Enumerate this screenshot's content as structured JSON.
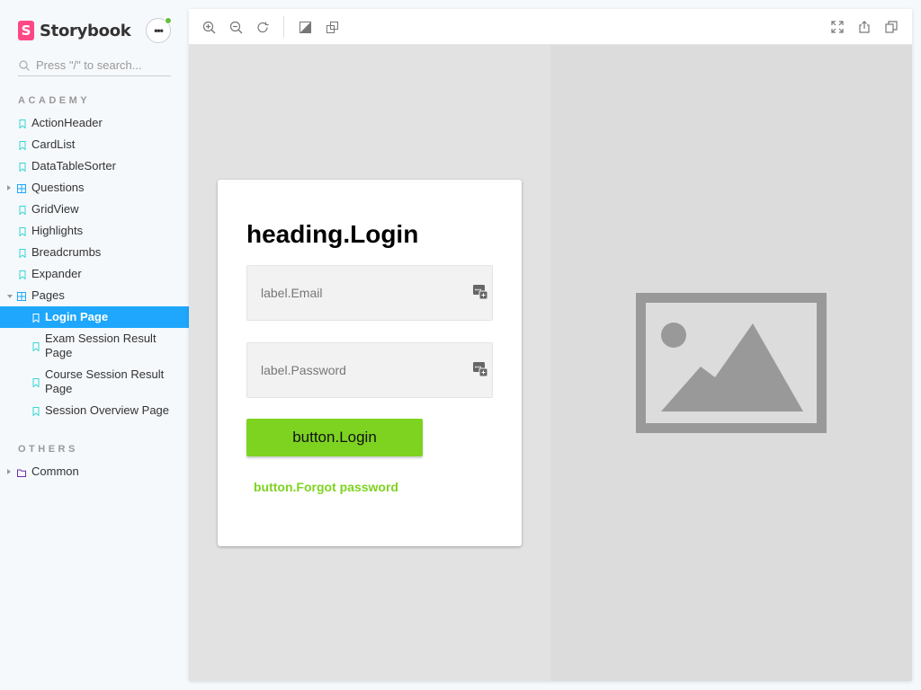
{
  "app": {
    "brand": "Storybook"
  },
  "search": {
    "placeholder": "Press \"/\" to search..."
  },
  "sections": [
    {
      "title": "ACADEMY"
    },
    {
      "title": "OTHERS"
    }
  ],
  "nav": [
    {
      "label": "ActionHeader",
      "kind": "story"
    },
    {
      "label": "CardList",
      "kind": "story"
    },
    {
      "label": "DataTableSorter",
      "kind": "story"
    },
    {
      "label": "Questions",
      "kind": "component",
      "expanded": false
    },
    {
      "label": "GridView",
      "kind": "story"
    },
    {
      "label": "Highlights",
      "kind": "story"
    },
    {
      "label": "Breadcrumbs",
      "kind": "story"
    },
    {
      "label": "Expander",
      "kind": "story"
    },
    {
      "label": "Pages",
      "kind": "component",
      "expanded": true
    },
    {
      "label": "Login Page",
      "kind": "story",
      "active": true
    },
    {
      "label": "Exam Session Result Page",
      "kind": "story"
    },
    {
      "label": "Course Session Result Page",
      "kind": "story"
    },
    {
      "label": "Session Overview Page",
      "kind": "story"
    },
    {
      "label": "Common",
      "kind": "folder",
      "expanded": false
    }
  ],
  "toolbar": {
    "left": [
      "zoom-in-icon",
      "zoom-out-icon",
      "zoom-reset-icon",
      "background-icon",
      "outline-icon"
    ],
    "right": [
      "fullscreen-icon",
      "share-icon",
      "copy-icon"
    ]
  },
  "login": {
    "heading": "heading.Login",
    "email_placeholder": "label.Email",
    "password_placeholder": "label.Password",
    "login_button": "button.Login",
    "forgot_button": "button.Forgot password"
  },
  "colors": {
    "accent": "#1ea7fd",
    "brand": "#ff4785",
    "primary_button": "#7ed321",
    "status_dot": "#66bf3c"
  }
}
